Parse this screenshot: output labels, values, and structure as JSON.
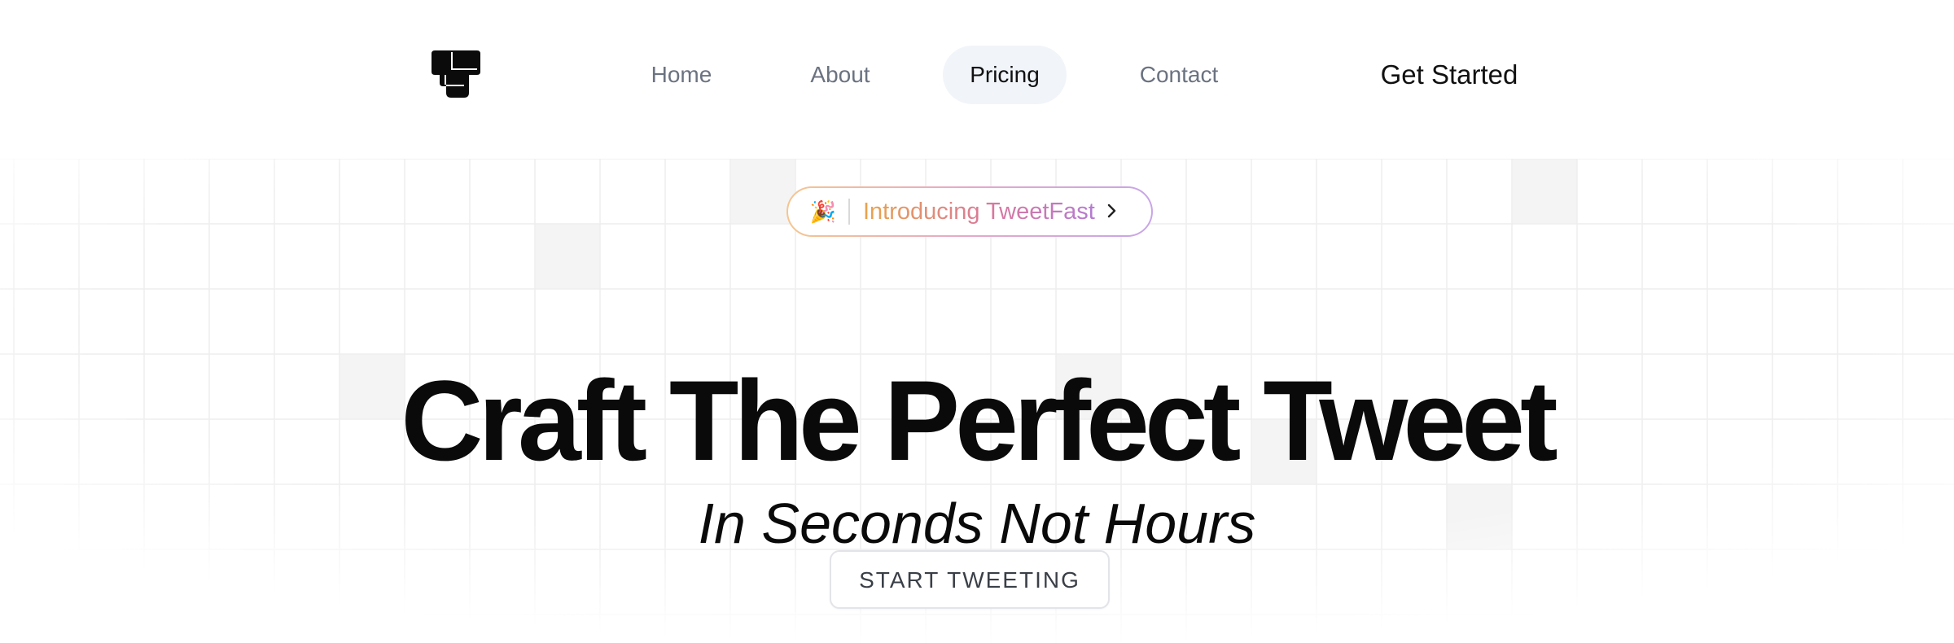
{
  "nav": {
    "logo_icon": "tweetfast-logo-icon",
    "links": [
      {
        "label": "Home",
        "active": false
      },
      {
        "label": "About",
        "active": false
      },
      {
        "label": "Pricing",
        "active": true
      },
      {
        "label": "Contact",
        "active": false
      }
    ],
    "get_started_label": "Get Started"
  },
  "hero": {
    "badge": {
      "emoji": "🎉",
      "icon": "party-popper-icon",
      "text": "Introducing TweetFast",
      "chevron_icon": "chevron-right-icon"
    },
    "headline": "Craft The Perfect Tweet",
    "subheadline": "In Seconds Not Hours",
    "cta_label": "START TWEETING"
  },
  "colors": {
    "text_primary": "#0a0a0a",
    "nav_muted": "#6b7280",
    "nav_active_bg": "#f1f4f9",
    "badge_gradient_start": "#e9a44a",
    "badge_gradient_mid": "#d9789e",
    "badge_gradient_end": "#b57ad2",
    "grid_line": "#eeeeee",
    "grid_cell_fill": "#f4f4f4"
  }
}
